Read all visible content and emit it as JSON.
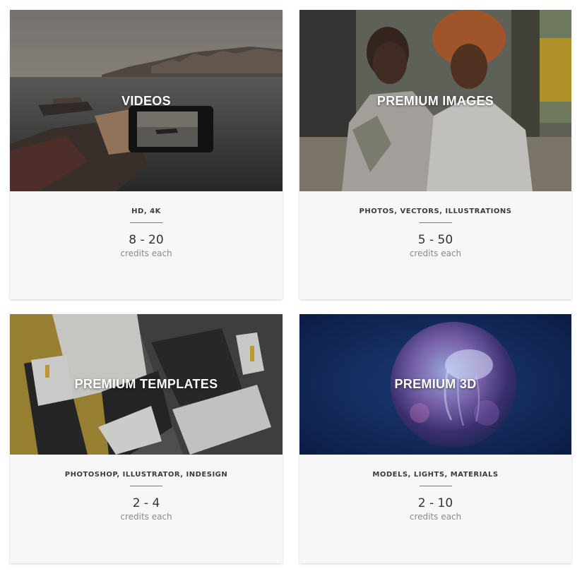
{
  "cards": [
    {
      "title": "VIDEOS",
      "formats": "HD, 4K",
      "credits": "8 - 20",
      "credits_label": "credits each",
      "image": "phone-photographing-boat-on-water"
    },
    {
      "title": "PREMIUM IMAGES",
      "formats": "PHOTOS, VECTORS, ILLUSTRATIONS",
      "credits": "5 - 50",
      "credits_label": "credits each",
      "image": "two-people-smiling-on-street"
    },
    {
      "title": "PREMIUM TEMPLATES",
      "formats": "PHOTOSHOP, ILLUSTRATOR, INDESIGN",
      "credits": "2 - 4",
      "credits_label": "credits each",
      "image": "stationery-branding-mockup"
    },
    {
      "title": "PREMIUM 3D",
      "formats": "MODELS, LIGHTS, MATERIALS",
      "credits": "2 - 10",
      "credits_label": "credits each",
      "image": "jellyfish-in-sphere"
    }
  ]
}
